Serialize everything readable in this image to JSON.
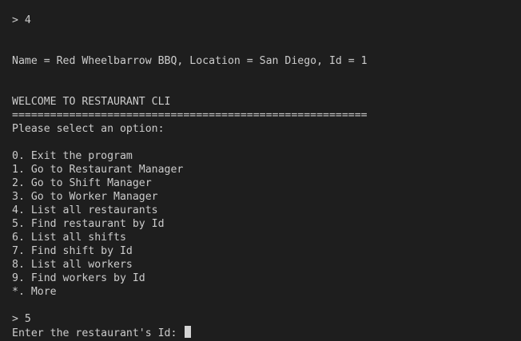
{
  "terminal": {
    "lines": [
      "> 4",
      "Name = Red Wheelbarrow BBQ, Location = San Diego, Id = 1",
      "WELCOME TO RESTAURANT CLI",
      "========================================================",
      "Please select an option:",
      "0. Exit the program",
      "1. Go to Restaurant Manager",
      "2. Go to Shift Manager",
      "3. Go to Worker Manager",
      "4. List all restaurants",
      "5. Find restaurant by Id",
      "6. List all shifts",
      "7. Find shift by Id",
      "8. List all workers",
      "9. Find workers by Id",
      "*. More",
      "> 5",
      "Enter the restaurant's Id: "
    ],
    "colors": {
      "background": "#1e1e1e",
      "text": "#cccccc",
      "cursor": "#d4d4d4"
    }
  }
}
